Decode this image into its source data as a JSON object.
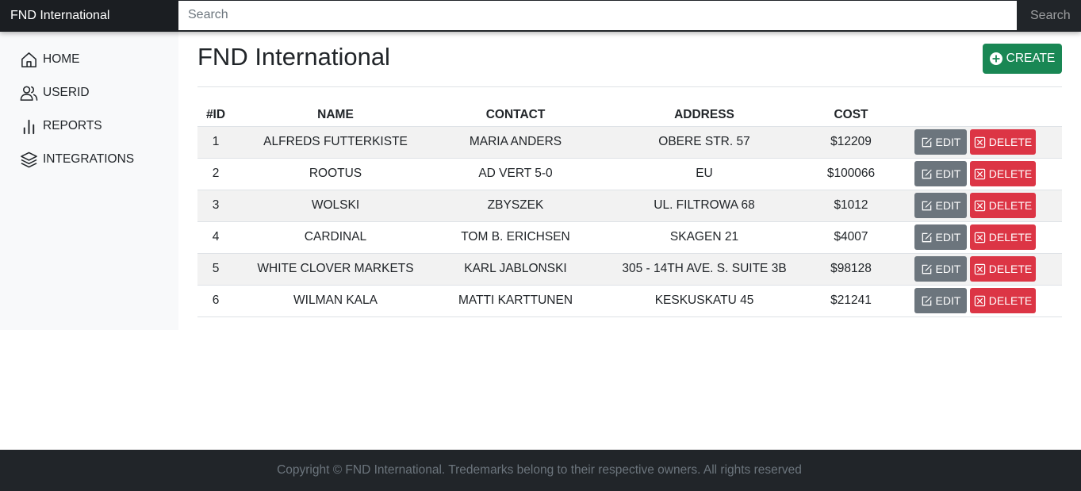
{
  "brand": "FND International",
  "search": {
    "placeholder": "Search",
    "button_label": "Search"
  },
  "sidebar": {
    "items": [
      {
        "label": "HOME",
        "icon": "home-icon"
      },
      {
        "label": "USERID",
        "icon": "users-icon"
      },
      {
        "label": "REPORTS",
        "icon": "bar-chart-icon"
      },
      {
        "label": "INTEGRATIONS",
        "icon": "layers-icon"
      }
    ]
  },
  "main": {
    "title": "FND International",
    "create_label": "CREATE",
    "table": {
      "headers": [
        "#ID",
        "NAME",
        "CONTACT",
        "ADDRESS",
        "COST"
      ],
      "edit_label": "EDIT",
      "delete_label": "DELETE",
      "rows": [
        {
          "id": "1",
          "name": "ALFREDS FUTTERKISTE",
          "contact": "MARIA ANDERS",
          "address": "OBERE STR. 57",
          "cost": "$12209"
        },
        {
          "id": "2",
          "name": "ROOTUS",
          "contact": "AD VERT 5-0",
          "address": "EU",
          "cost": "$100066"
        },
        {
          "id": "3",
          "name": "WOLSKI",
          "contact": "ZBYSZEK",
          "address": "UL. FILTROWA 68",
          "cost": "$1012"
        },
        {
          "id": "4",
          "name": "CARDINAL",
          "contact": "TOM B. ERICHSEN",
          "address": "SKAGEN 21",
          "cost": "$4007"
        },
        {
          "id": "5",
          "name": "WHITE CLOVER MARKETS",
          "contact": "KARL JABLONSKI",
          "address": "305 - 14TH AVE. S. SUITE 3B",
          "cost": "$98128"
        },
        {
          "id": "6",
          "name": "WILMAN KALA",
          "contact": "MATTI KARTTUNEN",
          "address": "KESKUSKATU 45",
          "cost": "$21241"
        }
      ]
    }
  },
  "footer": {
    "text": "Copyright © FND International. Tredemarks belong to their respective owners. All rights reserved"
  },
  "colors": {
    "dark": "#212529",
    "success": "#198754",
    "secondary": "#6c757d",
    "danger": "#dc3545",
    "sidebar_bg": "#f8f9fa"
  }
}
